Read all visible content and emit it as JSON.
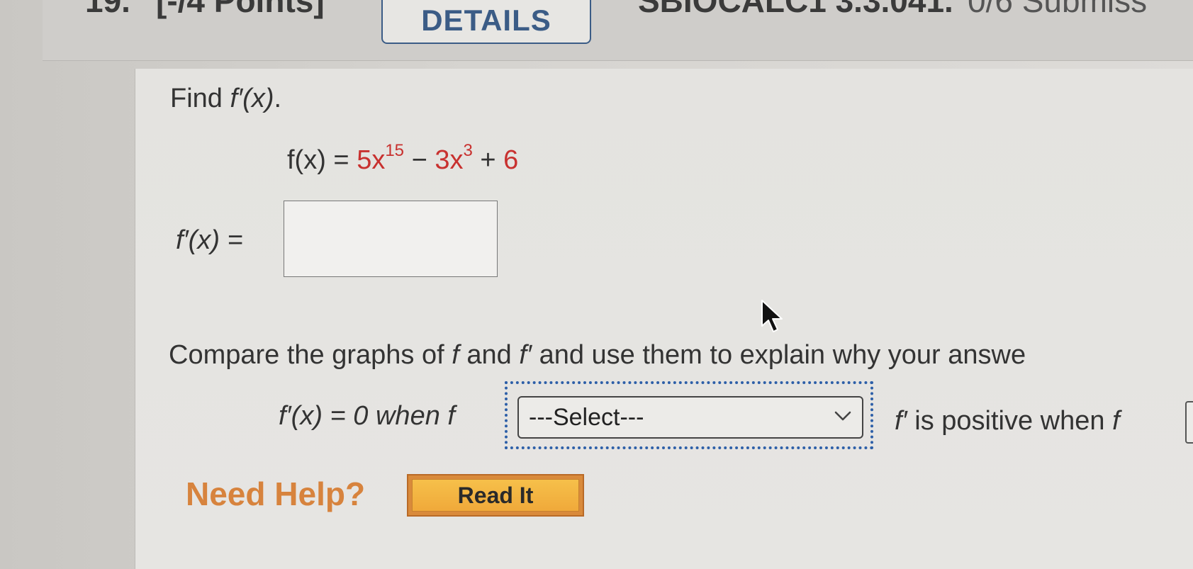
{
  "header": {
    "question_number": "19.",
    "points": "[-/4 Points]",
    "details_label": "DETAILS",
    "problem_id": "SBIOCALC1 3.3.041.",
    "submissions": "0/6 Submiss"
  },
  "question": {
    "prompt_find": "Find ",
    "prompt_fprime": "f′(x)",
    "prompt_end": ".",
    "fx_lhs": "f(x) = ",
    "term1_coef": "5x",
    "term1_exp": "15",
    "minus": " − ",
    "term2_coef": "3x",
    "term2_exp": "3",
    "plus": " + ",
    "const": "6",
    "answer_label": "f′(x) = "
  },
  "compare": {
    "text_start": "Compare the graphs of ",
    "f1": "f",
    "and": " and ",
    "f2": "f′",
    "text_end": " and use them to explain why your answe"
  },
  "select_row": {
    "lhs": "f′(x) = 0 when ",
    "lhs_f": "f",
    "select_value": "---Select---",
    "rhs_f": "f′",
    "rhs_text": " is positive when ",
    "rhs_f2": "f"
  },
  "help": {
    "need_help": "Need Help?",
    "read_it": "Read It"
  },
  "colors": {
    "accent_red": "#c8312f",
    "help_orange": "#d7833d",
    "focus_blue": "#2d5fa8"
  }
}
